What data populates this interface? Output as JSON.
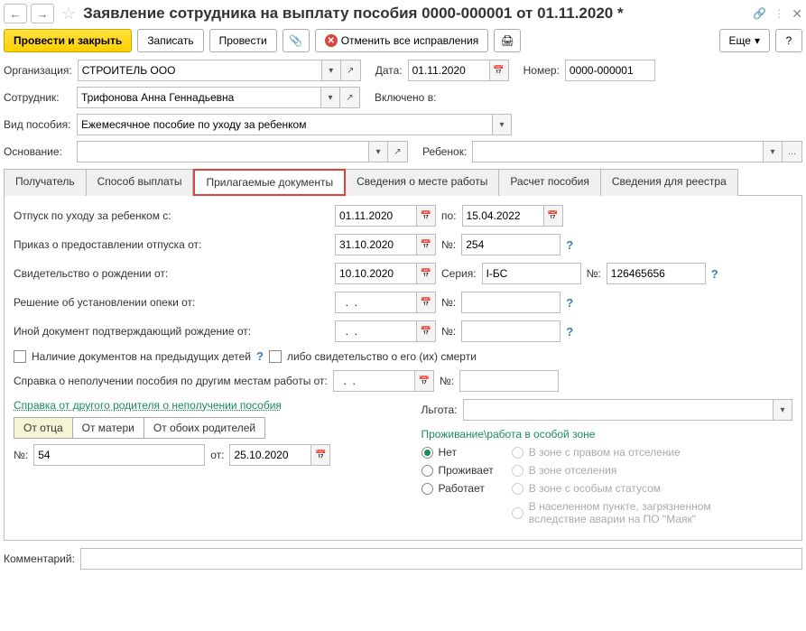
{
  "header": {
    "title": "Заявление сотрудника на выплату пособия 0000-000001 от 01.11.2020 *"
  },
  "toolbar": {
    "submit_close": "Провести и закрыть",
    "save": "Записать",
    "submit": "Провести",
    "cancel_all": "Отменить все исправления",
    "more": "Еще"
  },
  "fields": {
    "org_label": "Организация:",
    "org_value": "СТРОИТЕЛЬ ООО",
    "date_label": "Дата:",
    "date_value": "01.11.2020",
    "number_label": "Номер:",
    "number_value": "0000-000001",
    "employee_label": "Сотрудник:",
    "employee_value": "Трифонова Анна Геннадьевна",
    "included_label": "Включено в:",
    "benefit_type_label": "Вид пособия:",
    "benefit_type_value": "Ежемесячное пособие по уходу за ребенком",
    "basis_label": "Основание:",
    "child_label": "Ребенок:"
  },
  "tabs": [
    "Получатель",
    "Способ выплаты",
    "Прилагаемые документы",
    "Сведения о месте работы",
    "Расчет пособия",
    "Сведения для реестра"
  ],
  "docs": {
    "leave_from_label": "Отпуск по уходу за ребенком с:",
    "leave_from": "01.11.2020",
    "to_label": "по:",
    "leave_to": "15.04.2022",
    "order_label": "Приказ о предоставлении отпуска от:",
    "order_date": "31.10.2020",
    "num_label": "№:",
    "order_num": "254",
    "birth_cert_label": "Свидетельство о рождении от:",
    "birth_cert_date": "10.10.2020",
    "series_label": "Серия:",
    "birth_series": "I-БС",
    "birth_num": "126465656",
    "custody_label": "Решение об установлении опеки от:",
    "other_doc_label": "Иной документ подтверждающий рождение от:",
    "empty_date": "  .  .    ",
    "prev_children": "Наличие документов на предыдущих детей",
    "death_cert": "либо свидетельство о его (их) смерти",
    "no_benefit_cert_label": "Справка о неполучении пособия по другим местам работы от:",
    "other_parent_link": "Справка от другого родителя о неполучении пособия",
    "from_father": "От отца",
    "from_mother": "От матери",
    "from_both": "От обоих родителей",
    "ref_num": "54",
    "ref_date_label": "от:",
    "ref_date": "25.10.2020",
    "privilege_label": "Льгота:",
    "zone_title": "Проживание\\работа в особой зоне",
    "zone_no": "Нет",
    "zone_lives": "Проживает",
    "zone_works": "Работает",
    "zone_right": "В зоне с правом на отселение",
    "zone_evac": "В зоне отселения",
    "zone_special": "В зоне с особым статусом",
    "zone_mayak": "В населенном пункте, загрязненном вследствие аварии на ПО \"Маяк\""
  },
  "comment_label": "Комментарий:"
}
